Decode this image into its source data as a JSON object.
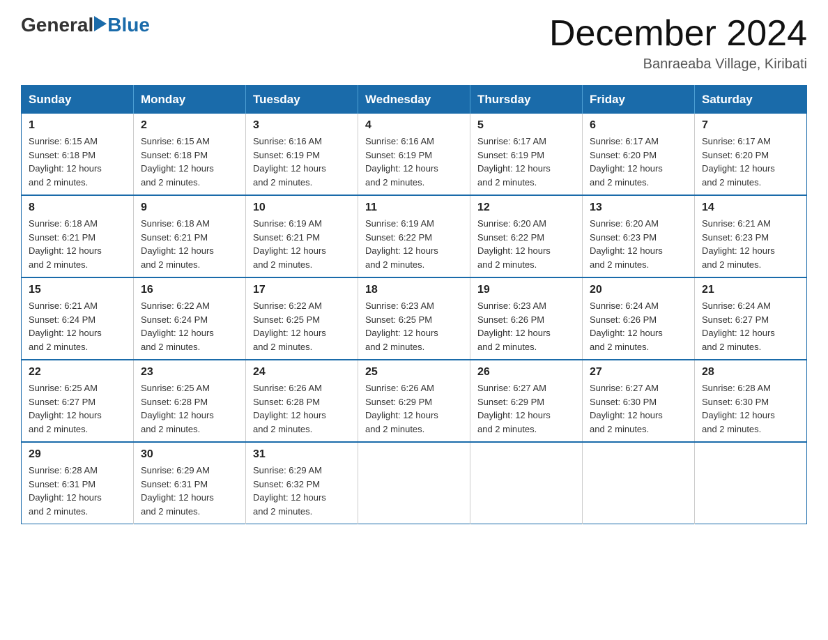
{
  "header": {
    "logo_general": "General",
    "logo_blue": "Blue",
    "month_title": "December 2024",
    "location": "Banraeaba Village, Kiribati"
  },
  "weekdays": [
    "Sunday",
    "Monday",
    "Tuesday",
    "Wednesday",
    "Thursday",
    "Friday",
    "Saturday"
  ],
  "weeks": [
    [
      {
        "day": "1",
        "sunrise": "6:15 AM",
        "sunset": "6:18 PM",
        "daylight": "12 hours and 2 minutes."
      },
      {
        "day": "2",
        "sunrise": "6:15 AM",
        "sunset": "6:18 PM",
        "daylight": "12 hours and 2 minutes."
      },
      {
        "day": "3",
        "sunrise": "6:16 AM",
        "sunset": "6:19 PM",
        "daylight": "12 hours and 2 minutes."
      },
      {
        "day": "4",
        "sunrise": "6:16 AM",
        "sunset": "6:19 PM",
        "daylight": "12 hours and 2 minutes."
      },
      {
        "day": "5",
        "sunrise": "6:17 AM",
        "sunset": "6:19 PM",
        "daylight": "12 hours and 2 minutes."
      },
      {
        "day": "6",
        "sunrise": "6:17 AM",
        "sunset": "6:20 PM",
        "daylight": "12 hours and 2 minutes."
      },
      {
        "day": "7",
        "sunrise": "6:17 AM",
        "sunset": "6:20 PM",
        "daylight": "12 hours and 2 minutes."
      }
    ],
    [
      {
        "day": "8",
        "sunrise": "6:18 AM",
        "sunset": "6:21 PM",
        "daylight": "12 hours and 2 minutes."
      },
      {
        "day": "9",
        "sunrise": "6:18 AM",
        "sunset": "6:21 PM",
        "daylight": "12 hours and 2 minutes."
      },
      {
        "day": "10",
        "sunrise": "6:19 AM",
        "sunset": "6:21 PM",
        "daylight": "12 hours and 2 minutes."
      },
      {
        "day": "11",
        "sunrise": "6:19 AM",
        "sunset": "6:22 PM",
        "daylight": "12 hours and 2 minutes."
      },
      {
        "day": "12",
        "sunrise": "6:20 AM",
        "sunset": "6:22 PM",
        "daylight": "12 hours and 2 minutes."
      },
      {
        "day": "13",
        "sunrise": "6:20 AM",
        "sunset": "6:23 PM",
        "daylight": "12 hours and 2 minutes."
      },
      {
        "day": "14",
        "sunrise": "6:21 AM",
        "sunset": "6:23 PM",
        "daylight": "12 hours and 2 minutes."
      }
    ],
    [
      {
        "day": "15",
        "sunrise": "6:21 AM",
        "sunset": "6:24 PM",
        "daylight": "12 hours and 2 minutes."
      },
      {
        "day": "16",
        "sunrise": "6:22 AM",
        "sunset": "6:24 PM",
        "daylight": "12 hours and 2 minutes."
      },
      {
        "day": "17",
        "sunrise": "6:22 AM",
        "sunset": "6:25 PM",
        "daylight": "12 hours and 2 minutes."
      },
      {
        "day": "18",
        "sunrise": "6:23 AM",
        "sunset": "6:25 PM",
        "daylight": "12 hours and 2 minutes."
      },
      {
        "day": "19",
        "sunrise": "6:23 AM",
        "sunset": "6:26 PM",
        "daylight": "12 hours and 2 minutes."
      },
      {
        "day": "20",
        "sunrise": "6:24 AM",
        "sunset": "6:26 PM",
        "daylight": "12 hours and 2 minutes."
      },
      {
        "day": "21",
        "sunrise": "6:24 AM",
        "sunset": "6:27 PM",
        "daylight": "12 hours and 2 minutes."
      }
    ],
    [
      {
        "day": "22",
        "sunrise": "6:25 AM",
        "sunset": "6:27 PM",
        "daylight": "12 hours and 2 minutes."
      },
      {
        "day": "23",
        "sunrise": "6:25 AM",
        "sunset": "6:28 PM",
        "daylight": "12 hours and 2 minutes."
      },
      {
        "day": "24",
        "sunrise": "6:26 AM",
        "sunset": "6:28 PM",
        "daylight": "12 hours and 2 minutes."
      },
      {
        "day": "25",
        "sunrise": "6:26 AM",
        "sunset": "6:29 PM",
        "daylight": "12 hours and 2 minutes."
      },
      {
        "day": "26",
        "sunrise": "6:27 AM",
        "sunset": "6:29 PM",
        "daylight": "12 hours and 2 minutes."
      },
      {
        "day": "27",
        "sunrise": "6:27 AM",
        "sunset": "6:30 PM",
        "daylight": "12 hours and 2 minutes."
      },
      {
        "day": "28",
        "sunrise": "6:28 AM",
        "sunset": "6:30 PM",
        "daylight": "12 hours and 2 minutes."
      }
    ],
    [
      {
        "day": "29",
        "sunrise": "6:28 AM",
        "sunset": "6:31 PM",
        "daylight": "12 hours and 2 minutes."
      },
      {
        "day": "30",
        "sunrise": "6:29 AM",
        "sunset": "6:31 PM",
        "daylight": "12 hours and 2 minutes."
      },
      {
        "day": "31",
        "sunrise": "6:29 AM",
        "sunset": "6:32 PM",
        "daylight": "12 hours and 2 minutes."
      },
      null,
      null,
      null,
      null
    ]
  ],
  "labels": {
    "sunrise": "Sunrise:",
    "sunset": "Sunset:",
    "daylight": "Daylight:"
  }
}
